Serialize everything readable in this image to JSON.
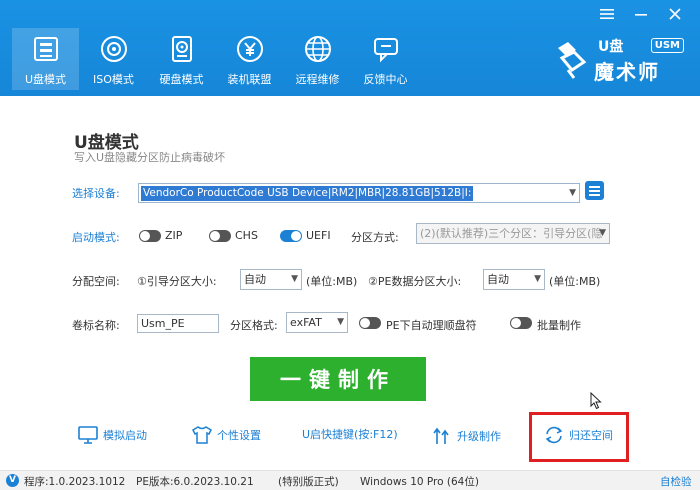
{
  "nav": [
    {
      "label": "U盘模式",
      "icon": "usb-drive-icon",
      "active": true
    },
    {
      "label": "ISO模式",
      "icon": "disc-icon"
    },
    {
      "label": "硬盘模式",
      "icon": "hard-disk-icon"
    },
    {
      "label": "装机联盟",
      "icon": "yen-circle-icon"
    },
    {
      "label": "远程维修",
      "icon": "globe-icon"
    },
    {
      "label": "反馈中心",
      "icon": "chat-bubble-icon"
    }
  ],
  "logo": {
    "prefix": "U盘",
    "name": "魔术师",
    "badge": "USM"
  },
  "main": {
    "title": "U盘模式",
    "subtitle": "写入U盘隐藏分区防止病毒破坏"
  },
  "form": {
    "device_label": "选择设备:",
    "device_value": "VendorCo ProductCode USB Device|RM2|MBR|28.81GB|512B|I:",
    "boot_mode_label": "启动模式:",
    "boot_zip": "ZIP",
    "boot_chs": "CHS",
    "boot_uefi": "UEFI",
    "partition_method_label": "分区方式:",
    "partition_method_value": "(2)(默认推荐)三个分区：引导分区(隐",
    "alloc_label": "分配空间:",
    "boot_part_size_label": "①引导分区大小:",
    "boot_part_size_value": "自动",
    "unit1": "(单位:MB)",
    "pe_part_size_label": "②PE数据分区大小:",
    "pe_part_size_value": "自动",
    "unit2": "(单位:MB)",
    "volume_label": "卷标名称:",
    "volume_value": "Usm_PE",
    "format_label": "分区格式:",
    "format_value": "exFAT",
    "auto_clean_label": "PE下自动理顺盘符",
    "batch_label": "批量制作"
  },
  "make_button": "一键制作",
  "tools": {
    "simulate": "模拟启动",
    "personalize": "个性设置",
    "hotkey": "U启快捷键(按:F12)",
    "upgrade": "升级制作",
    "restore": "归还空间"
  },
  "status": {
    "program_version": "程序:1.0.2023.1012",
    "pe_version": "PE版本:6.0.2023.10.21",
    "edition": "(特别版正式)",
    "os": "Windows 10 Pro (64位)",
    "self_check": "自检验"
  },
  "colors": {
    "header_blue": "#1686d8",
    "accent_blue": "#1c80d4",
    "make_green": "#2db02d",
    "highlight_red": "#e02020"
  }
}
